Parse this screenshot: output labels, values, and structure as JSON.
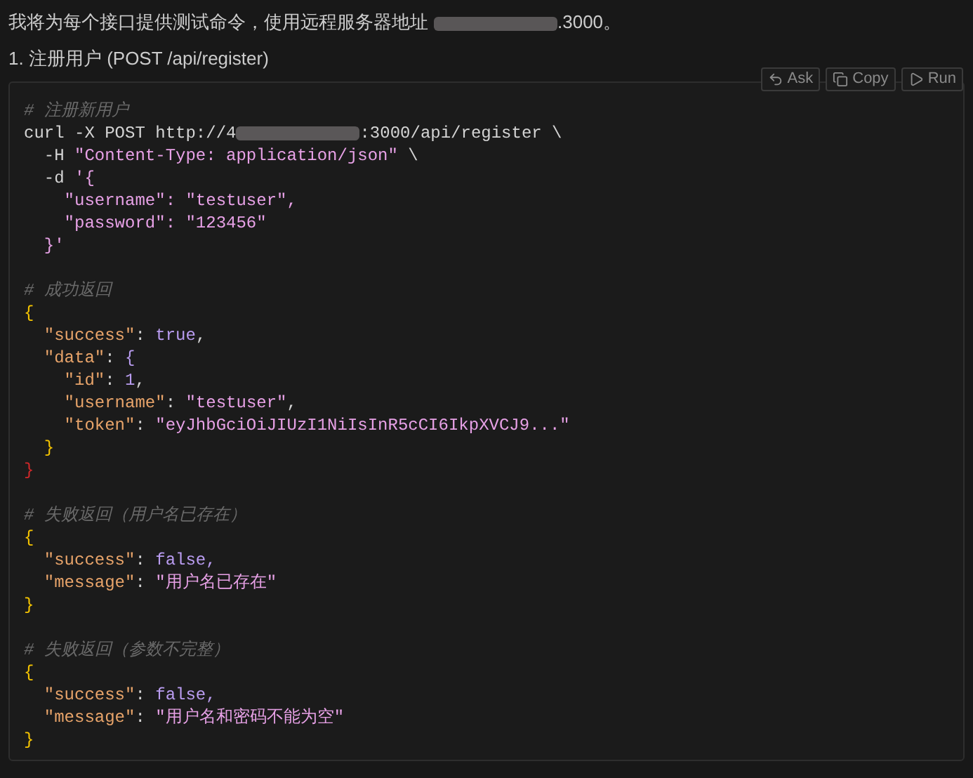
{
  "intro": {
    "before": "我将为每个接口提供测试命令，使用远程服务器地址",
    "after": ".3000。"
  },
  "section_title": "1. 注册用户 (POST /api/register)",
  "code_actions": [
    {
      "label": "Ask",
      "kind": "ask"
    },
    {
      "label": "Copy",
      "kind": "copy"
    },
    {
      "label": "Run",
      "kind": "run"
    }
  ],
  "code_lines": [
    {
      "kind": "code",
      "tokens": [
        {
          "text": "# 注册新用户",
          "kind": "comment"
        }
      ]
    },
    {
      "kind": "code",
      "tokens": [
        {
          "text": "curl -X POST http://4",
          "kind": "plain"
        },
        {
          "kind": "redacted"
        },
        {
          "text": ":3000/api/register \\",
          "kind": "plain"
        }
      ]
    },
    {
      "kind": "code",
      "tokens": [
        {
          "text": "  -H ",
          "kind": "plain"
        },
        {
          "text": "\"Content-Type: application/json\"",
          "kind": "string"
        },
        {
          "text": " \\",
          "kind": "plain"
        }
      ]
    },
    {
      "kind": "code",
      "tokens": [
        {
          "text": "  -d ",
          "kind": "plain"
        },
        {
          "text": "'{",
          "kind": "string"
        }
      ]
    },
    {
      "kind": "code",
      "tokens": [
        {
          "text": "    \"username\": \"testuser\",",
          "kind": "string"
        }
      ]
    },
    {
      "kind": "code",
      "tokens": [
        {
          "text": "    \"password\": \"123456\"",
          "kind": "string"
        }
      ]
    },
    {
      "kind": "code",
      "tokens": [
        {
          "text": "  }'",
          "kind": "string"
        }
      ]
    },
    {
      "kind": "blank"
    },
    {
      "kind": "code",
      "tokens": [
        {
          "text": "# 成功返回",
          "kind": "comment"
        }
      ]
    },
    {
      "kind": "code",
      "tokens": [
        {
          "text": "{",
          "kind": "brace"
        }
      ]
    },
    {
      "kind": "code",
      "tokens": [
        {
          "text": "  \"success\"",
          "kind": "key"
        },
        {
          "text": ": ",
          "kind": "plain"
        },
        {
          "text": "true",
          "kind": "bool"
        },
        {
          "text": ",",
          "kind": "plain"
        }
      ]
    },
    {
      "kind": "code",
      "tokens": [
        {
          "text": "  \"data\"",
          "kind": "key"
        },
        {
          "text": ": ",
          "kind": "plain"
        },
        {
          "text": "{",
          "kind": "bool"
        }
      ]
    },
    {
      "kind": "code",
      "tokens": [
        {
          "text": "    \"id\"",
          "kind": "key"
        },
        {
          "text": ": ",
          "kind": "plain"
        },
        {
          "text": "1",
          "kind": "bool"
        },
        {
          "text": ",",
          "kind": "plain"
        }
      ]
    },
    {
      "kind": "code",
      "tokens": [
        {
          "text": "    \"username\"",
          "kind": "key"
        },
        {
          "text": ": ",
          "kind": "plain"
        },
        {
          "text": "\"testuser\"",
          "kind": "string"
        },
        {
          "text": ",",
          "kind": "plain"
        }
      ]
    },
    {
      "kind": "code",
      "tokens": [
        {
          "text": "    \"token\"",
          "kind": "key"
        },
        {
          "text": ": ",
          "kind": "plain"
        },
        {
          "text": "\"eyJhbGciOiJIUzI1NiIsInR5cCI6IkpXVCJ9...\"",
          "kind": "string"
        }
      ]
    },
    {
      "kind": "code",
      "tokens": [
        {
          "text": "  }",
          "kind": "brace"
        }
      ]
    },
    {
      "kind": "code",
      "tokens": [
        {
          "text": "}",
          "kind": "error"
        }
      ]
    },
    {
      "kind": "blank"
    },
    {
      "kind": "code",
      "tokens": [
        {
          "text": "# 失败返回（用户名已存在）",
          "kind": "comment"
        }
      ]
    },
    {
      "kind": "code",
      "tokens": [
        {
          "text": "{",
          "kind": "brace"
        }
      ]
    },
    {
      "kind": "code",
      "tokens": [
        {
          "text": "  \"success\"",
          "kind": "key"
        },
        {
          "text": ": ",
          "kind": "plain"
        },
        {
          "text": "false",
          "kind": "bool"
        },
        {
          "text": ",",
          "kind": "bool"
        }
      ]
    },
    {
      "kind": "code",
      "tokens": [
        {
          "text": "  \"message\"",
          "kind": "key"
        },
        {
          "text": ": ",
          "kind": "plain"
        },
        {
          "text": "\"用户名已存在\"",
          "kind": "string"
        }
      ]
    },
    {
      "kind": "code",
      "tokens": [
        {
          "text": "}",
          "kind": "brace"
        }
      ]
    },
    {
      "kind": "blank"
    },
    {
      "kind": "code",
      "tokens": [
        {
          "text": "# 失败返回（参数不完整）",
          "kind": "comment"
        }
      ]
    },
    {
      "kind": "code",
      "tokens": [
        {
          "text": "{",
          "kind": "brace"
        }
      ]
    },
    {
      "kind": "code",
      "tokens": [
        {
          "text": "  \"success\"",
          "kind": "key"
        },
        {
          "text": ": ",
          "kind": "plain"
        },
        {
          "text": "false",
          "kind": "bool"
        },
        {
          "text": ",",
          "kind": "bool"
        }
      ]
    },
    {
      "kind": "code",
      "tokens": [
        {
          "text": "  \"message\"",
          "kind": "key"
        },
        {
          "text": ": ",
          "kind": "plain"
        },
        {
          "text": "\"用户名和密码不能为空\"",
          "kind": "string"
        }
      ]
    },
    {
      "kind": "code",
      "tokens": [
        {
          "text": "}",
          "kind": "brace"
        }
      ]
    }
  ]
}
